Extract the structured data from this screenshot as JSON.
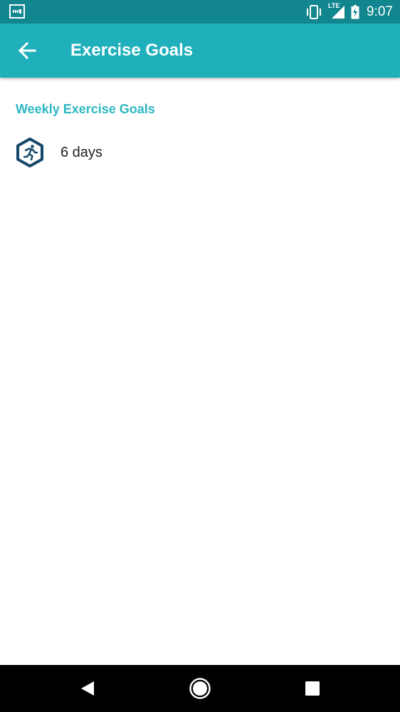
{
  "status_bar": {
    "time": "9:07",
    "network_label": "LTE",
    "icons": [
      "notification-icon",
      "vibrate-icon",
      "signal-icon",
      "battery-charging-icon"
    ]
  },
  "app_bar": {
    "title": "Exercise Goals",
    "back_icon": "arrow-back-icon"
  },
  "section": {
    "header": "Weekly Exercise Goals",
    "goal": {
      "icon": "running-person-icon",
      "value": "6 days"
    }
  },
  "nav_bar": {
    "buttons": [
      "back-triangle",
      "home-circle",
      "recents-square"
    ]
  },
  "colors": {
    "status_bar": "#12868f",
    "app_bar": "#1fb0bb",
    "accent_text": "#2cb8c2",
    "icon_dark": "#15476a"
  }
}
